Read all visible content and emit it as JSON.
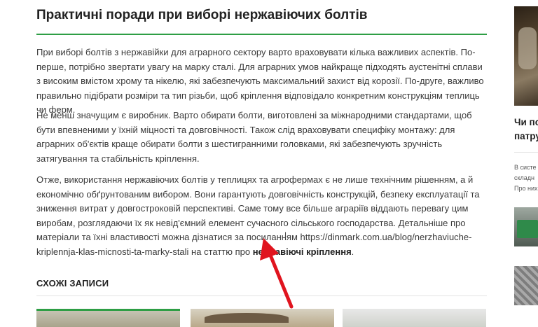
{
  "article": {
    "title": "Практичні поради при виборі нержавіючих болтів",
    "p1": "При виборі болтів з нержавійки для аграрного сектору варто враховувати кілька важливих аспектів. По-перше, потрібно звертати увагу на марку сталі. Для аграрних умов найкраще підходять аустенітні сплави з високим вмістом хрому та нікелю, які забезпечують максимальний захист від корозії. По-друге, важливо правильно підібрати розміри та тип різьби, щоб кріплення відповідало конкретним конструкціям теплиць чи ферм.",
    "p2": "Не менш значущим є виробник. Варто обирати болти, виготовлені за міжнародними стандартами, щоб бути впевненими у їхній міцності та довговічності. Також слід враховувати специфіку монтажу: для аграрних об'єктів краще обирати болти з шестигранними головками, які забезпечують зручність затягування та стабільність кріплення.",
    "p3_text": "Отже, використання нержавіючих болтів у теплицях та агрофермах є не лише технічним рішенням, а й економічно обґрунтованим вибором. Вони гарантують довговічність конструкцій, безпеку експлуатації та зниження витрат у довгостроковій перспективі. Саме тому все більше аграріїв віддають перевагу цим виробам, розглядаючи їх як невід'ємний елемент сучасного сільського господарства. Детальніше про матеріали та їхні властивості можна дізнатися за посиланням https://dinmark.com.ua/blog/nerzhaviuche-kriplennja-klas-micnosti-ta-marky-stali на статтю про ",
    "p3_bold": "нержавіючі кріплення",
    "p3_end": "."
  },
  "related": {
    "title": "СХОЖІ ЗАПИСИ"
  },
  "sidebar": {
    "post_title_line1": "Чи по",
    "post_title_line2": "патру",
    "excerpt_line1": "В систе",
    "excerpt_line2": "складн",
    "excerpt_line3": "Про них"
  },
  "colors": {
    "accent": "#2e9e45",
    "annotation_arrow": "#e0141e"
  },
  "icons": [
    "text-cursor-icon",
    "annotation-arrow-icon"
  ]
}
